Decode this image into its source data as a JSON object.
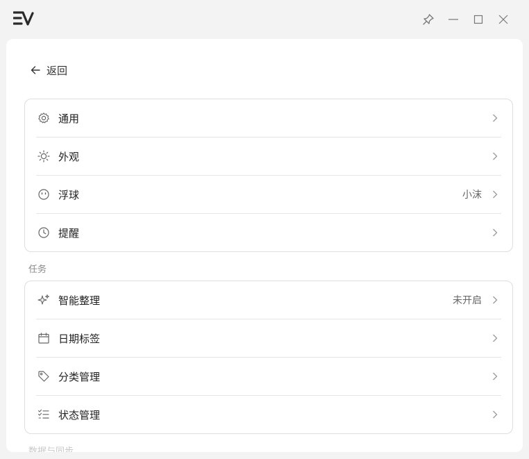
{
  "app": {
    "logo": "ev-logo"
  },
  "window_controls": {
    "pin": "pin-icon",
    "minimize": "minimize-icon",
    "maximize": "maximize-icon",
    "close": "close-icon"
  },
  "back": {
    "label": "返回"
  },
  "group1": {
    "items": [
      {
        "label": "通用",
        "value": "",
        "icon": "gear-icon"
      },
      {
        "label": "外观",
        "value": "",
        "icon": "sun-icon"
      },
      {
        "label": "浮球",
        "value": "小沫",
        "icon": "face-icon"
      },
      {
        "label": "提醒",
        "value": "",
        "icon": "clock-icon"
      }
    ]
  },
  "tasks": {
    "title": "任务",
    "items": [
      {
        "label": "智能整理",
        "value": "未开启",
        "icon": "sparkle-icon"
      },
      {
        "label": "日期标签",
        "value": "",
        "icon": "calendar-icon"
      },
      {
        "label": "分类管理",
        "value": "",
        "icon": "tag-icon"
      },
      {
        "label": "状态管理",
        "value": "",
        "icon": "checklist-icon"
      }
    ]
  },
  "next_section": {
    "title": "数据与同步"
  }
}
